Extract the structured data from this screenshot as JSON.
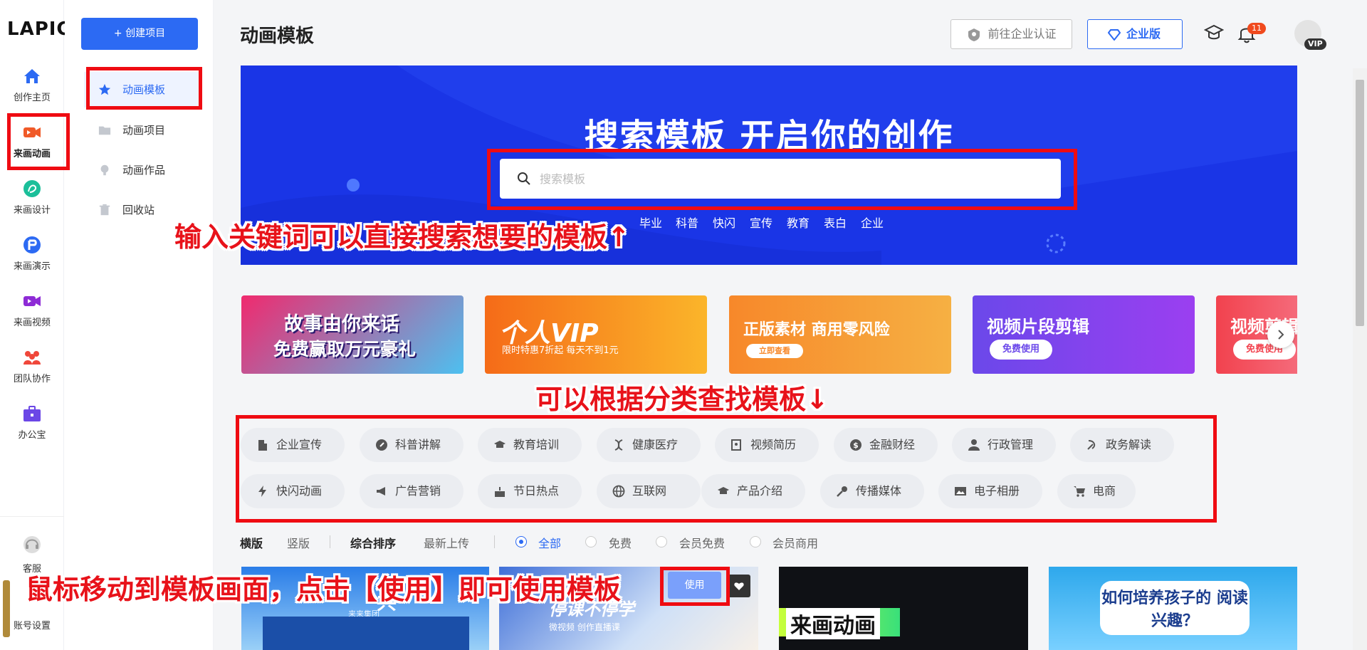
{
  "app": {
    "logo": "LAPIC",
    "page_title": "动画模板"
  },
  "rail": {
    "items": [
      {
        "label": "创作主页",
        "icon": "home-icon"
      },
      {
        "label": "来画动画",
        "icon": "camera-icon"
      },
      {
        "label": "来画设计",
        "icon": "design-icon"
      },
      {
        "label": "来画演示",
        "icon": "presentation-icon"
      },
      {
        "label": "来画视频",
        "icon": "video-icon"
      },
      {
        "label": "团队协作",
        "icon": "team-icon"
      },
      {
        "label": "办公宝",
        "icon": "briefcase-icon"
      }
    ],
    "service_label": "客服",
    "account_label": "账号设置"
  },
  "sidebar": {
    "create_button": "+ 创建项目",
    "items": [
      {
        "label": "动画模板",
        "icon": "star-icon"
      },
      {
        "label": "动画项目",
        "icon": "folder-icon"
      },
      {
        "label": "动画作品",
        "icon": "lightbulb-icon"
      },
      {
        "label": "回收站",
        "icon": "trash-icon"
      }
    ]
  },
  "header": {
    "cert_button": "前往企业认证",
    "enterprise_button": "企业版",
    "notification_count": "11",
    "vip_badge": "VIP"
  },
  "banner": {
    "title": "搜索模板 开启你的创作",
    "search_placeholder": "搜索模板",
    "search_value": "",
    "tags": [
      "毕业",
      "科普",
      "快闪",
      "宣传",
      "教育",
      "表白",
      "企业"
    ]
  },
  "promos": [
    {
      "title_line1": "故事由你来话",
      "title_line2": "免费赢取万元豪礼"
    },
    {
      "title": "个人VIP",
      "subtitle": "限时特惠7折起  每天不到1元"
    },
    {
      "title": "正版素材 商用零风险",
      "button": "立即查看"
    },
    {
      "title": "视频片段剪辑",
      "button": "免费使用"
    },
    {
      "title": "视频剪辑",
      "button": "免费使用"
    }
  ],
  "categories": [
    {
      "label": "企业宣传",
      "icon": "building-icon"
    },
    {
      "label": "科普讲解",
      "icon": "compass-icon"
    },
    {
      "label": "教育培训",
      "icon": "graduation-cap-icon"
    },
    {
      "label": "健康医疗",
      "icon": "dna-icon"
    },
    {
      "label": "视频简历",
      "icon": "resume-icon"
    },
    {
      "label": "金融财经",
      "icon": "dollar-icon"
    },
    {
      "label": "行政管理",
      "icon": "user-icon"
    },
    {
      "label": "政务解读",
      "icon": "hammer-sickle-icon"
    },
    {
      "label": "快闪动画",
      "icon": "lightning-icon"
    },
    {
      "label": "广告营销",
      "icon": "megaphone-icon"
    },
    {
      "label": "节日热点",
      "icon": "cake-icon"
    },
    {
      "label": "互联网",
      "icon": "globe-icon"
    },
    {
      "label": "产品介绍",
      "icon": "graduation-cap-icon"
    },
    {
      "label": "传播媒体",
      "icon": "microphone-icon"
    },
    {
      "label": "电子相册",
      "icon": "photo-icon"
    },
    {
      "label": "电商",
      "icon": "cart-icon"
    }
  ],
  "filters": {
    "orientation": [
      "横版",
      "竖版"
    ],
    "sort": [
      "综合排序",
      "最新上传"
    ],
    "price": [
      "全部",
      "免费",
      "会员免费",
      "会员商用"
    ],
    "selected_price": "全部"
  },
  "thumbnails": [
    {
      "text": "共",
      "subtext": "来来集团"
    },
    {
      "text": "停课不停学",
      "subtext": "微视频  创作直播课"
    },
    {
      "text": "来画动画"
    },
    {
      "text": "如何培养孩子的 阅读兴趣？"
    }
  ],
  "hover": {
    "use_button": "使用"
  },
  "annotations": {
    "search_note": "输入关键词可以直接搜索想要的模板↑",
    "category_note": "可以根据分类查找模板↓",
    "use_note": "鼠标移动到模板画面，点击【使用】即可使用模板"
  },
  "colors": {
    "primary": "#2c6af3",
    "banner": "#1a35e6",
    "annotation_red": "#ef0b12"
  }
}
